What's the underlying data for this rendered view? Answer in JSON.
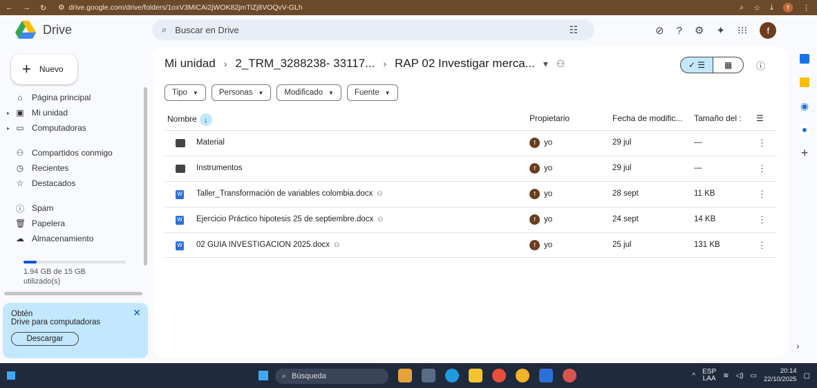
{
  "browser": {
    "url": "drive.google.com/drive/folders/1oxV3MiCAi2jWOK82jmTiZj8VOQvV-GLh",
    "profile_initial": "f"
  },
  "app": {
    "name": "Drive"
  },
  "search": {
    "placeholder": "Buscar en Drive"
  },
  "user_initial": "f",
  "new_button": {
    "label": "Nuevo"
  },
  "sidebar": {
    "items": [
      {
        "label": "Página principal",
        "icon": "home-icon"
      },
      {
        "label": "Mi unidad",
        "icon": "my-drive-icon"
      },
      {
        "label": "Computadoras",
        "icon": "computer-icon"
      },
      {
        "label": "Compartidos conmigo",
        "icon": "shared-icon"
      },
      {
        "label": "Recientes",
        "icon": "clock-icon"
      },
      {
        "label": "Destacados",
        "icon": "star-icon"
      },
      {
        "label": "Spam",
        "icon": "spam-icon"
      },
      {
        "label": "Papelera",
        "icon": "trash-icon"
      },
      {
        "label": "Almacenamiento",
        "icon": "cloud-icon"
      }
    ],
    "storage": {
      "text": "1.94 GB de 15 GB utilizado(s)",
      "used_fraction": 0.13
    }
  },
  "promo": {
    "title": "Obtén",
    "subtitle": "Drive para computadoras",
    "button": "Descargar"
  },
  "breadcrumb": {
    "items": [
      "Mi unidad",
      "2_TRM_3288238- 33117...",
      "RAP 02 Investigar merca..."
    ]
  },
  "filters": [
    "Tipo",
    "Personas",
    "Modificado",
    "Fuente"
  ],
  "table": {
    "headers": {
      "name": "Nombre",
      "owner": "Propietario",
      "modified": "Fecha de modific...",
      "size": "Tamaño del :"
    },
    "rows": [
      {
        "type": "folder",
        "name": "Material",
        "shared": false,
        "owner": "yo",
        "modified": "29 jul",
        "size": "—"
      },
      {
        "type": "folder",
        "name": "Instrumentos",
        "shared": false,
        "owner": "yo",
        "modified": "29 jul",
        "size": "—"
      },
      {
        "type": "word",
        "name": "Taller_Transformación de variables colombia.docx",
        "shared": true,
        "owner": "yo",
        "modified": "28 sept",
        "size": "11 KB"
      },
      {
        "type": "word",
        "name": "Ejercicio Práctico hipotesis 25 de septiembre.docx",
        "shared": true,
        "owner": "yo",
        "modified": "24 sept",
        "size": "14 KB"
      },
      {
        "type": "word",
        "name": "02 GUIA INVESTIGACION 2025.docx",
        "shared": true,
        "owner": "yo",
        "modified": "25 jul",
        "size": "131 KB"
      }
    ]
  },
  "taskbar": {
    "search": "Búsqueda",
    "lang": "ESP",
    "lang2": "LAA",
    "time": "20:14",
    "date": "22/10/2025"
  },
  "colors": {
    "accent": "#0b57d0",
    "browser_bar": "#6b4a2c",
    "taskbar": "#1f2a3d"
  }
}
